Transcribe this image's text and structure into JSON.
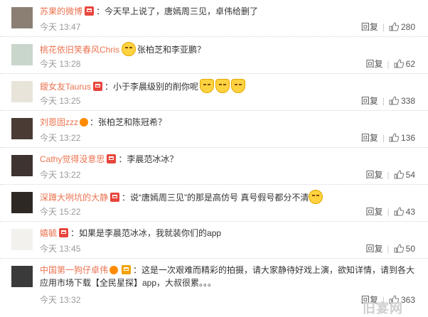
{
  "reply_label": "回复",
  "comments": [
    {
      "user": "苏果的微博",
      "badge": "red",
      "text": "：今天早上说了，唐嫣周三见，卓伟给删了",
      "time": "今天 13:47",
      "likes": "280"
    },
    {
      "user": "桃花依旧笑春风Chris",
      "badge": "none",
      "emoji_before": true,
      "text": "张柏芝和李亚鹏？",
      "time": "今天 13:28",
      "likes": "62"
    },
    {
      "user": "鑀女友Taurus",
      "badge": "red",
      "text": "：小于李晨级别的削你呢",
      "emoji_after_count": 3,
      "time": "今天 13:25",
      "likes": "338"
    },
    {
      "user": "刘恩固zzz",
      "badge": "vip",
      "text": "：张柏芝和陈冠希？",
      "time": "今天 13:22",
      "likes": "136"
    },
    {
      "user": "Cathy觉得没意思",
      "badge": "red",
      "text": "：李晨范冰冰？",
      "time": "今天 13:22",
      "likes": "54"
    },
    {
      "user": "深蹲大咧坑的大静",
      "badge": "red",
      "text": "：说“唐嫣周三见”的那是高仿号 真号假号都分不清",
      "emoji_after_count": 1,
      "time": "今天 15:22",
      "likes": "43"
    },
    {
      "user": "嬉毓",
      "badge": "red",
      "text": "：如果是李晨范冰冰，我就装你们的app",
      "time": "今天 13:45",
      "likes": "50"
    },
    {
      "user": "中国第一狗仔卓伟",
      "badge": "gold",
      "text": "：这是一次艰难而精彩的拍摄，请大家静待好戏上演，欲知详情，请到各大",
      "text2": "应用市场下载【全民星探】app，大叔很累。。。",
      "time": "今天 13:32",
      "likes": "363"
    }
  ],
  "watermark": "旧宴网"
}
